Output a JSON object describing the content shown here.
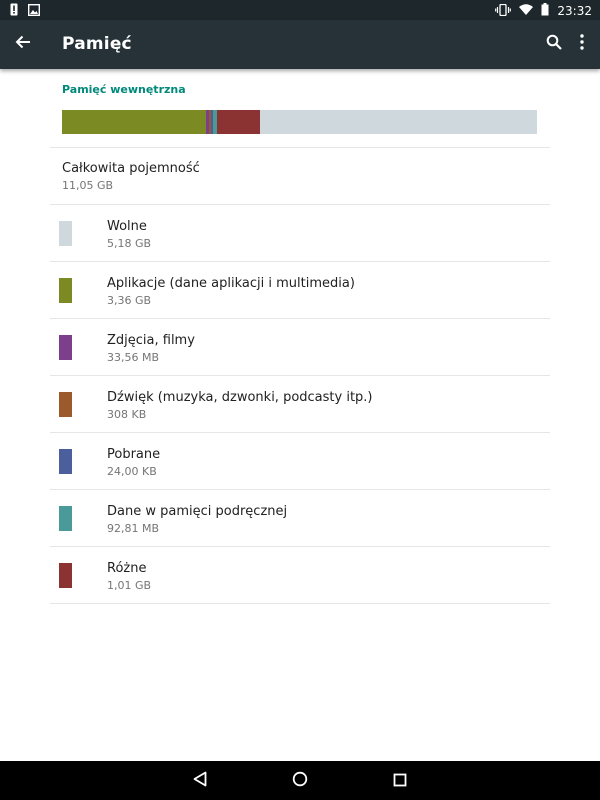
{
  "status_bar": {
    "time": "23:32"
  },
  "app_bar": {
    "title": "Pamięć",
    "icons": [
      "back-arrow-icon",
      "search-icon",
      "more-vert-icon"
    ]
  },
  "storage": {
    "section_title": "Pamięć wewnętrzna",
    "bar_segments": [
      {
        "name": "Aplikacje",
        "fraction": 0.304,
        "color": "#7b8a22"
      },
      {
        "name": "Zdjęcia, filmy",
        "fraction": 0.006,
        "color": "#7b3f8c"
      },
      {
        "name": "Dźwięk",
        "fraction": 0.004,
        "color": "#9a5a2c"
      },
      {
        "name": "Pobrane",
        "fraction": 0.004,
        "color": "#4a5f9b"
      },
      {
        "name": "Dane w pamięci podręcznej",
        "fraction": 0.008,
        "color": "#4a9a9a"
      },
      {
        "name": "Różne",
        "fraction": 0.091,
        "color": "#8b3232"
      }
    ],
    "free_color": "#cfd8dc"
  },
  "total": {
    "label": "Całkowita pojemność",
    "value": "11,05 GB"
  },
  "categories": [
    {
      "label": "Wolne",
      "value": "5,18 GB",
      "color": "#cfd8dc"
    },
    {
      "label": "Aplikacje (dane aplikacji i multimedia)",
      "value": "3,36 GB",
      "color": "#7b8a22"
    },
    {
      "label": "Zdjęcia, filmy",
      "value": "33,56 MB",
      "color": "#7b3f8c"
    },
    {
      "label": "Dźwięk (muzyka, dzwonki, podcasty itp.)",
      "value": "308 KB",
      "color": "#9a5a2c"
    },
    {
      "label": "Pobrane",
      "value": "24,00 KB",
      "color": "#4a5f9b"
    },
    {
      "label": "Dane w pamięci podręcznej",
      "value": "92,81 MB",
      "color": "#4a9a9a"
    },
    {
      "label": "Różne",
      "value": "1,01 GB",
      "color": "#8b3232"
    }
  ],
  "nav_bar": {
    "icons": [
      "back-triangle-icon",
      "home-circle-icon",
      "recents-square-icon"
    ]
  },
  "colors": {
    "status_bar": "#1e272c",
    "app_bar": "#263238",
    "accent": "#00897b"
  }
}
